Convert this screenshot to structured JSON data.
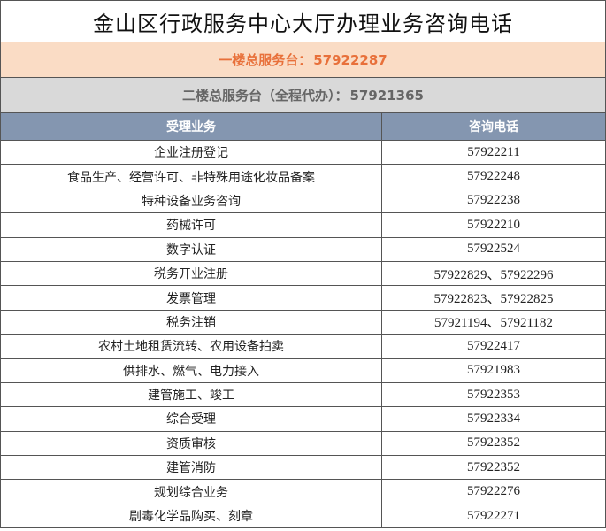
{
  "title": "金山区行政服务中心大厅办理业务咨询电话",
  "hall1": {
    "label": "一楼总服务台：",
    "phone": "57922287"
  },
  "hall2": {
    "label": "二楼总服务台（全程代办）：",
    "phone": "57921365"
  },
  "table": {
    "headers": [
      "受理业务",
      "咨询电话"
    ],
    "rows": [
      {
        "business": "企业注册登记",
        "phone": "57922211"
      },
      {
        "business": "食品生产、经营许可、非特殊用途化妆品备案",
        "phone": "57922248"
      },
      {
        "business": "特种设备业务咨询",
        "phone": "57922238"
      },
      {
        "business": "药械许可",
        "phone": "57922210"
      },
      {
        "business": "数字认证",
        "phone": "57922524"
      },
      {
        "business": "税务开业注册",
        "phone": "57922829、57922296"
      },
      {
        "business": "发票管理",
        "phone": "57922823、57922825"
      },
      {
        "business": "税务注销",
        "phone": "57921194、57921182"
      },
      {
        "business": "农村土地租赁流转、农用设备拍卖",
        "phone": "57922417"
      },
      {
        "business": "供排水、燃气、电力接入",
        "phone": "57921983"
      },
      {
        "business": "建管施工、竣工",
        "phone": "57922353"
      },
      {
        "business": "综合受理",
        "phone": "57922334"
      },
      {
        "business": "资质审核",
        "phone": "57922352"
      },
      {
        "business": "建管消防",
        "phone": "57922352"
      },
      {
        "business": "规划综合业务",
        "phone": "57922276"
      },
      {
        "business": "剧毒化学品购买、刻章",
        "phone": "57922271"
      }
    ]
  }
}
